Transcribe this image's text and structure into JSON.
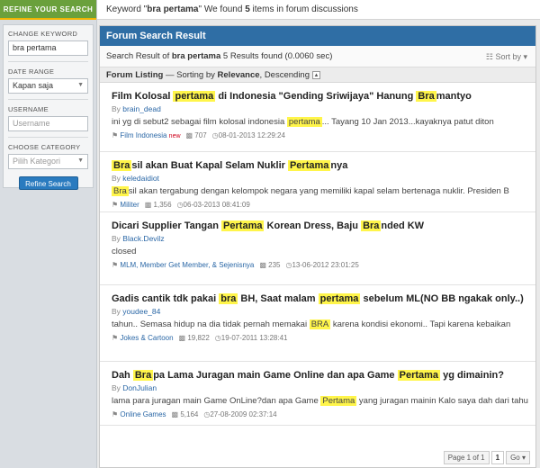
{
  "sidebar": {
    "refine_tab": "REFINE YOUR SEARCH",
    "keyword_label": "CHANGE KEYWORD",
    "keyword_value": "bra pertama",
    "date_label": "DATE RANGE",
    "date_value": "Kapan saja",
    "username_label": "USERNAME",
    "username_placeholder": "Username",
    "category_label": "CHOOSE CATEGORY",
    "category_value": "Pilih Kategori",
    "refine_button": "Refine Search"
  },
  "topbar": {
    "prefix": "Keyword \"",
    "keyword": "bra pertama",
    "middle": "\" We found ",
    "count": "5",
    "suffix": " items in forum discussions"
  },
  "panel": {
    "title": "Forum Search Result",
    "summary_prefix": "Search Result of ",
    "summary_keyword": "bra pertama",
    "summary_suffix": " 5 Results found (0.0060 sec)",
    "sort_label": "Sort by",
    "listing_label": "Forum Listing",
    "listing_sort_prefix": " — Sorting by ",
    "listing_sort_field": "Relevance",
    "listing_sort_order": ", Descending"
  },
  "results": [
    {
      "title_parts": [
        "Film Kolosal ",
        "pertama",
        " di Indonesia \"Gending Sriwijaya\" Hanung ",
        "Bra",
        "mantyo"
      ],
      "by": "By ",
      "author": "brain_dead",
      "snippet_parts": [
        "ini yg di sebut2 sebagai film kolosal indonesia ",
        "pertama",
        "... Tayang 10 Jan 2013...kayaknya patut diton"
      ],
      "forum": "Film Indonesia",
      "new": "new",
      "views": "707",
      "date": "08-01-2013 12:29:24"
    },
    {
      "title_parts": [
        "",
        "Bra",
        "sil akan Buat Kapal Selam Nuklir ",
        "Pertama",
        "nya"
      ],
      "by": "By ",
      "author": "keledaidiot",
      "snippet_parts": [
        "",
        "Bra",
        "sil akan tergabung dengan kelompok negara yang memiliki kapal selam bertenaga nuklir. Presiden B"
      ],
      "forum": "Militer",
      "views": "1,356",
      "date": "06-03-2013 08:41:09"
    },
    {
      "title_parts": [
        "Dicari Supplier Tangan ",
        "Pertama",
        " Korean Dress, Baju ",
        "Bra",
        "nded KW"
      ],
      "by": "By ",
      "author": "Black.Devilz",
      "snippet": "closed",
      "forum": "MLM, Member Get Member, & Sejenisnya",
      "views": "235",
      "date": "13-06-2012 23:01:25"
    },
    {
      "title_parts": [
        "Gadis cantik tdk pakai ",
        "bra",
        " BH, Saat malam ",
        "pertama",
        " sebelum ML(NO BB ngakak only..)"
      ],
      "by": "By ",
      "author": "youdee_84",
      "snippet_parts": [
        "tahun.. Semasa hidup na dia tidak pernah memakai ",
        "BRA",
        " karena kondisi ekonomi.. Tapi karena kebaikan"
      ],
      "forum": "Jokes & Cartoon",
      "views": "19,822",
      "date": "19-07-2011 13:28:41"
    },
    {
      "title_parts": [
        "Dah ",
        "Bra",
        "pa Lama Juragan main Game Online dan apa Game ",
        "Pertama",
        " yg dimainin?"
      ],
      "by": "By ",
      "author": "DonJulian",
      "snippet_parts": [
        "lama para juragan main Game OnLine?dan apa Game ",
        "Pertama",
        " yang juragan mainin Kalo saya dah dari tahu"
      ],
      "forum": "Online Games",
      "views": "5,164",
      "date": "27-08-2009 02:37:14"
    }
  ],
  "pager": {
    "label": "Page 1 of 1",
    "current": "1",
    "goto": "Go"
  },
  "icons": {
    "tag": "tag-icon",
    "views": "comment-icon",
    "date": "clock-icon"
  }
}
